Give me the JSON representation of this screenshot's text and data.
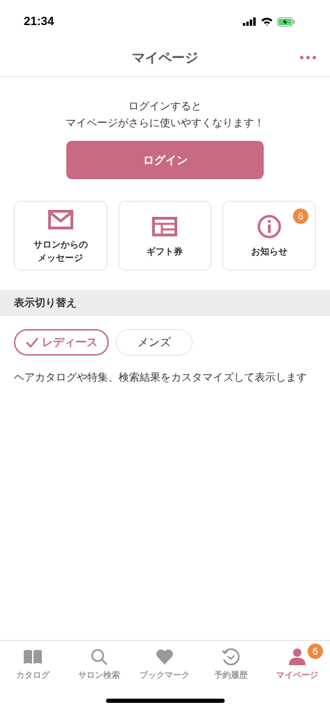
{
  "status_bar": {
    "time": "21:34"
  },
  "header": {
    "title": "マイページ"
  },
  "login": {
    "message_lines": [
      "ログインすると",
      "マイページがさらに使いやすくなります！"
    ],
    "button": "ログイン"
  },
  "tiles": [
    {
      "kind": "mail",
      "label_lines": [
        "サロンからの",
        "メッセージ"
      ]
    },
    {
      "kind": "gift",
      "label_lines": [
        "ギフト券"
      ]
    },
    {
      "kind": "info",
      "label_lines": [
        "お知らせ"
      ],
      "badge": "6"
    }
  ],
  "display_switch": {
    "heading": "表示切り替え",
    "options": [
      {
        "label": "レディース",
        "selected": true
      },
      {
        "label": "メンズ",
        "selected": false
      }
    ],
    "description": "ヘアカタログや特集、検索結果をカスタマイズして表示します"
  },
  "tab_bar": [
    {
      "kind": "book",
      "label": "カタログ",
      "selected": false
    },
    {
      "kind": "search",
      "label": "サロン検索",
      "selected": false
    },
    {
      "kind": "heart",
      "label": "ブックマーク",
      "selected": false
    },
    {
      "kind": "history",
      "label": "予約履歴",
      "selected": false
    },
    {
      "kind": "person",
      "label": "マイページ",
      "selected": true,
      "badge": "6"
    }
  ]
}
